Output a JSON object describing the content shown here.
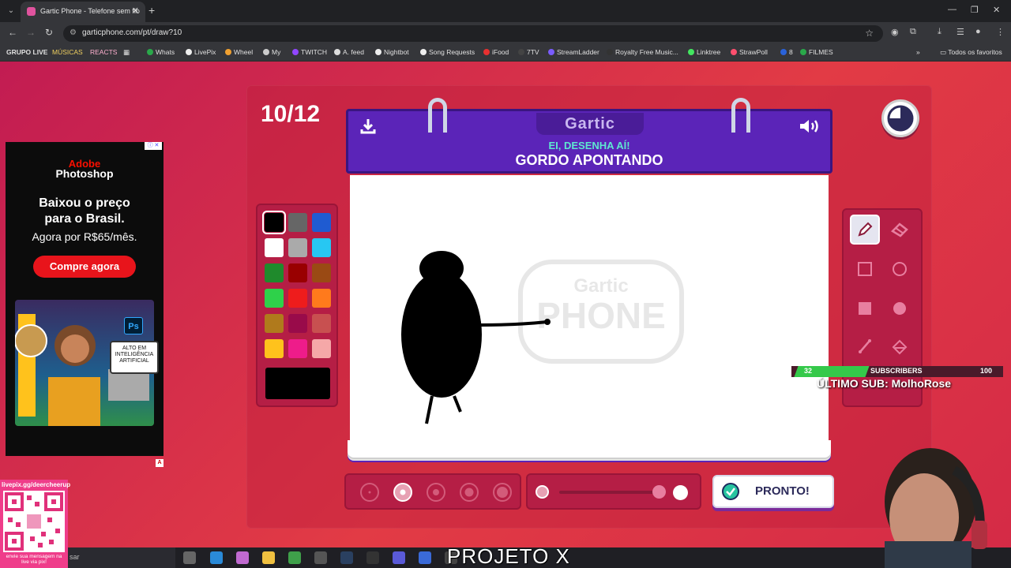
{
  "browser": {
    "tab_title": "Gartic Phone - Telefone sem fio",
    "url": "garticphone.com/pt/draw?10",
    "bookmarks": [
      "GRUPO LIVE",
      "MÚSICAS",
      "REACTS",
      "Whats",
      "LivePix",
      "Wheel",
      "My",
      "TWITCH",
      "A. feed",
      "Nightbot",
      "Song Requests",
      "iFood",
      "7TV",
      "StreamLadder",
      "Royalty Free Music...",
      "Linktree",
      "StrawPoll",
      "8",
      "FILMES"
    ],
    "all_bookmarks": "Todos os favoritos"
  },
  "game": {
    "round": "10/12",
    "logo": "Gartic",
    "prompt_label": "EI, DESENHA AÍ!",
    "prompt_word": "GORDO APONTANDO",
    "done_label": "PRONTO!",
    "selected_color": "#000000",
    "selected_tool": "pencil",
    "selected_size": 2,
    "colors": [
      "#000000",
      "#666666",
      "#1f5bd1",
      "#ffffff",
      "#aaaaaa",
      "#27c7f2",
      "#1f8a2c",
      "#990000",
      "#9a4a14",
      "#2ed14a",
      "#ee1c1c",
      "#ff7a1c",
      "#b07a1c",
      "#990b4a",
      "#c85050",
      "#ffc21c",
      "#ee1c8a",
      "#f5a8a8"
    ]
  },
  "ad": {
    "brand": "Adobe",
    "product": "Photoshop",
    "headline_1": "Baixou o preço",
    "headline_2": "para o Brasil.",
    "subline": "Agora por R$65/mês.",
    "cta": "Compre agora",
    "badge": "ALTO EM INTELIGÊNCIA ARTIFICIAL",
    "ps": "Ps"
  },
  "overlay": {
    "subs_current": "32",
    "subs_label": "SUBSCRIBERS",
    "subs_goal": "100",
    "subs_progress": 0.32,
    "last_sub": "ÚLTIMO SUB: MolhoRose",
    "qr_top": "livepix.gg/deercheerup",
    "qr_bottom": "envie sua mensagem na live via pix!",
    "stream_title": "PROJETO X",
    "search_text": "sar"
  }
}
